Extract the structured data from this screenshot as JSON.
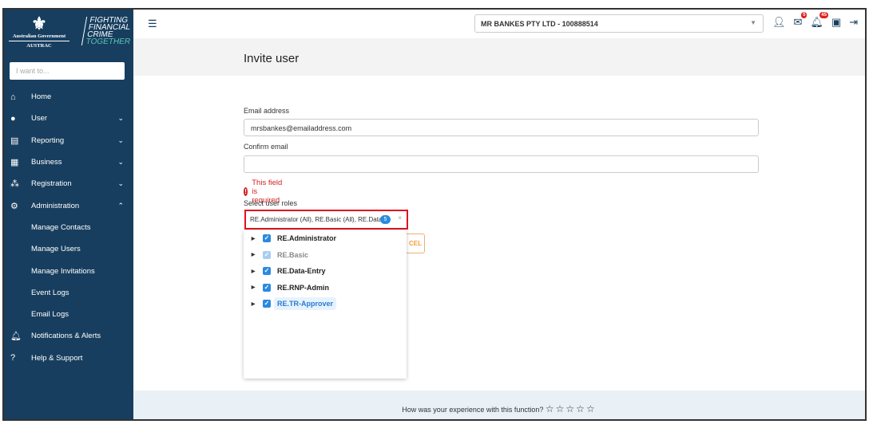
{
  "logo": {
    "gov": "Australian Government",
    "agency": "AUSTRAC",
    "tagline": [
      "FIGHTING",
      "FINANCIAL",
      "CRIME",
      "TOGETHER"
    ]
  },
  "search": {
    "placeholder": "I want to..."
  },
  "nav": [
    {
      "label": "Home",
      "icon": "home-icon"
    },
    {
      "label": "User",
      "icon": "user-circle-icon"
    },
    {
      "label": "Reporting",
      "icon": "report-icon"
    },
    {
      "label": "Business",
      "icon": "building-icon"
    },
    {
      "label": "Registration",
      "icon": "registration-icon"
    },
    {
      "label": "Administration",
      "icon": "admin-icon"
    },
    {
      "label": "Manage Contacts"
    },
    {
      "label": "Manage Users"
    },
    {
      "label": "Manage Invitations"
    },
    {
      "label": "Event Logs"
    },
    {
      "label": "Email Logs"
    },
    {
      "label": "Notifications & Alerts",
      "icon": "bell-icon"
    },
    {
      "label": "Help & Support",
      "icon": "help-icon"
    }
  ],
  "header": {
    "org": "MR BANKES PTY LTD - 100888514",
    "mail_count": "5",
    "alert_count": "45"
  },
  "page": {
    "title": "Invite user"
  },
  "form": {
    "email_label": "Email address",
    "email_value": "mrsbankes@emailaddress.com",
    "confirm_label": "Confirm email",
    "confirm_value": "",
    "error": "This field is required",
    "roles_label": "Select user roles",
    "roles_value": "RE.Administrator (All), RE.Basic (All), RE.Data...",
    "roles_count": "5",
    "cancel": "CEL",
    "roles": [
      {
        "label": "RE.Administrator",
        "checked": true
      },
      {
        "label": "RE.Basic",
        "checked": true,
        "disabled": true
      },
      {
        "label": "RE.Data-Entry",
        "checked": true
      },
      {
        "label": "RE.RNP-Admin",
        "checked": true
      },
      {
        "label": "RE.TR-Approver",
        "checked": true,
        "active": true
      }
    ]
  },
  "footer": {
    "question": "How was your experience with this function?",
    "rating": 0,
    "max_rating": 5
  }
}
